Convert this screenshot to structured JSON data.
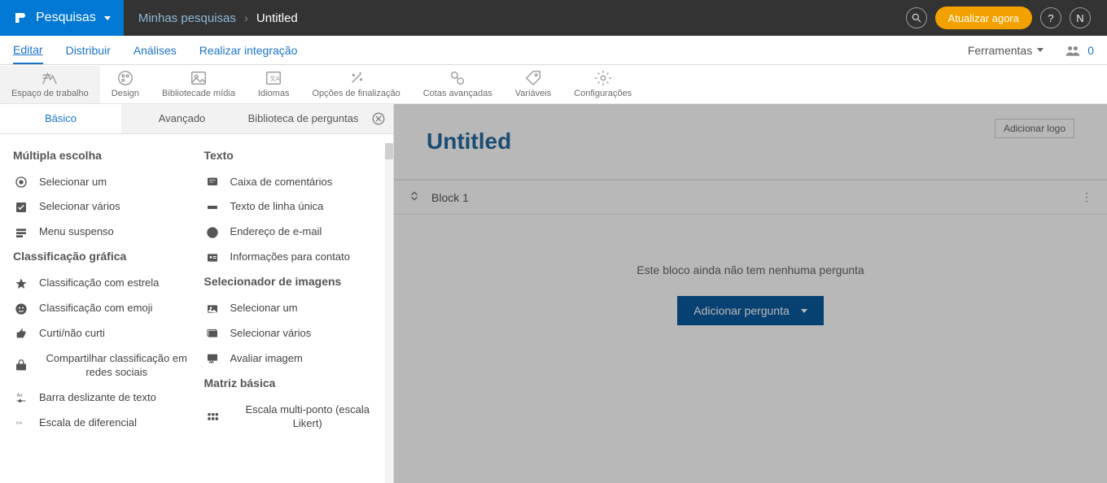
{
  "brand": {
    "label": "Pesquisas"
  },
  "breadcrumb": {
    "root": "Minhas pesquisas",
    "current": "Untitled"
  },
  "top_actions": {
    "update": "Atualizar agora",
    "help": "?",
    "user_initial": "N"
  },
  "nav": {
    "items": [
      "Editar",
      "Distribuir",
      "Análises",
      "Realizar integração"
    ],
    "tools_label": "Ferramentas",
    "collab_count": "0"
  },
  "ribbon": [
    {
      "id": "workspace",
      "label": "Espaço de trabalho"
    },
    {
      "id": "design",
      "label": "Design"
    },
    {
      "id": "media",
      "label": "Bibliotecade mídia"
    },
    {
      "id": "lang",
      "label": "Idiomas"
    },
    {
      "id": "finish",
      "label": "Opções de finalização"
    },
    {
      "id": "quota",
      "label": "Cotas avançadas"
    },
    {
      "id": "vars",
      "label": "Variáveis"
    },
    {
      "id": "settings",
      "label": "Configurações"
    }
  ],
  "panel_tabs": [
    "Básico",
    "Avançado",
    "Biblioteca de perguntas"
  ],
  "groups_left": [
    {
      "title": "Múltipla escolha",
      "items": [
        {
          "icon": "radio",
          "label": "Selecionar um"
        },
        {
          "icon": "check",
          "label": "Selecionar vários"
        },
        {
          "icon": "dropdown",
          "label": "Menu suspenso"
        }
      ]
    },
    {
      "title": "Classificação gráfica",
      "items": [
        {
          "icon": "star",
          "label": "Classificação com estrela"
        },
        {
          "icon": "emoji",
          "label": "Classificação com emoji"
        },
        {
          "icon": "thumb",
          "label": "Curti/não curti"
        },
        {
          "icon": "share",
          "label": "Compartilhar classificação em redes sociais",
          "center": true
        },
        {
          "icon": "slider",
          "label": "Barra deslizante de texto"
        },
        {
          "icon": "diff",
          "label": "Escala de diferencial"
        }
      ]
    }
  ],
  "groups_right": [
    {
      "title": "Texto",
      "items": [
        {
          "icon": "comment",
          "label": "Caixa de comentários"
        },
        {
          "icon": "textline",
          "label": "Texto de linha única"
        },
        {
          "icon": "at",
          "label": "Endereço de e-mail"
        },
        {
          "icon": "contact",
          "label": "Informações para contato"
        }
      ]
    },
    {
      "title": "Selecionador de imagens",
      "items": [
        {
          "icon": "img",
          "label": "Selecionar um"
        },
        {
          "icon": "imgs",
          "label": "Selecionar vários"
        },
        {
          "icon": "imgrate",
          "label": "Avaliar imagem"
        }
      ]
    },
    {
      "title": "Matriz básica",
      "items": [
        {
          "icon": "matrix",
          "label": "Escala multi-ponto (escala Likert)",
          "center": true
        }
      ]
    }
  ],
  "canvas": {
    "add_logo": "Adicionar logo",
    "survey_title": "Untitled",
    "block_name": "Block 1",
    "empty_msg": "Este bloco ainda não tem nenhuma pergunta",
    "add_question": "Adicionar pergunta"
  }
}
